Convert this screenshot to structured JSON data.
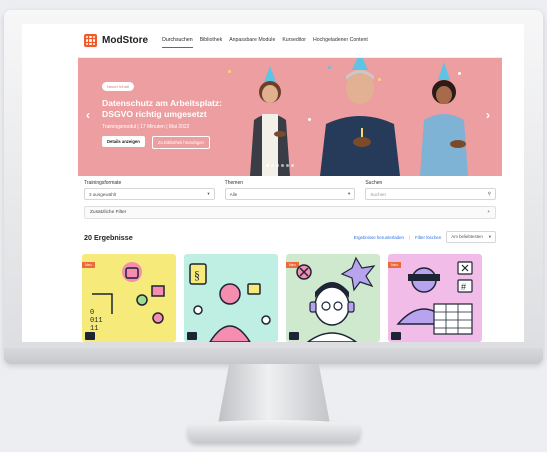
{
  "app": {
    "logo_text": "ModStore"
  },
  "nav": {
    "items": [
      {
        "label": "Durchsuchen",
        "active": true
      },
      {
        "label": "Bibliothek",
        "active": false
      },
      {
        "label": "Anpassbare Module",
        "active": false
      },
      {
        "label": "Kurseditor",
        "active": false
      },
      {
        "label": "Hochgeladener Content",
        "active": false
      }
    ]
  },
  "hero": {
    "badge": "Neuer Inhalt",
    "title": "Datenschutz am Arbeitsplatz: DSGVO richtig umgesetzt",
    "subtitle": "Trainingsmodul | 17 Minuten | Mai 2022",
    "primary_button": "Details anzeigen",
    "secondary_button": "Zu Bibliothek hinzufügen",
    "background_color": "#ec9ea1"
  },
  "filters": {
    "training_formats": {
      "label": "Trainingsformate",
      "value": "3 ausgewählt"
    },
    "topics": {
      "label": "Themen",
      "value": "Alle"
    },
    "search": {
      "label": "Suchen",
      "placeholder": "Suchen"
    },
    "extra_filters": "Zusätzliche Filter"
  },
  "results": {
    "count_label": "20 Ergebnisse",
    "download_link": "Ergebnisse herunterladen",
    "reset_link": "Filter löschen",
    "sort_value": "Am beliebtesten"
  },
  "cards": [
    {
      "badge": "Neu",
      "color": "#f6eb7a",
      "icon": "lock-circuit-icon"
    },
    {
      "badge": "",
      "color": "#bfeee3",
      "icon": "person-lock-icon"
    },
    {
      "badge": "Neu",
      "color": "#cfe9cf",
      "icon": "person-headset-icon"
    },
    {
      "badge": "Neu",
      "color": "#f1bde8",
      "icon": "person-masked-icon"
    }
  ]
}
